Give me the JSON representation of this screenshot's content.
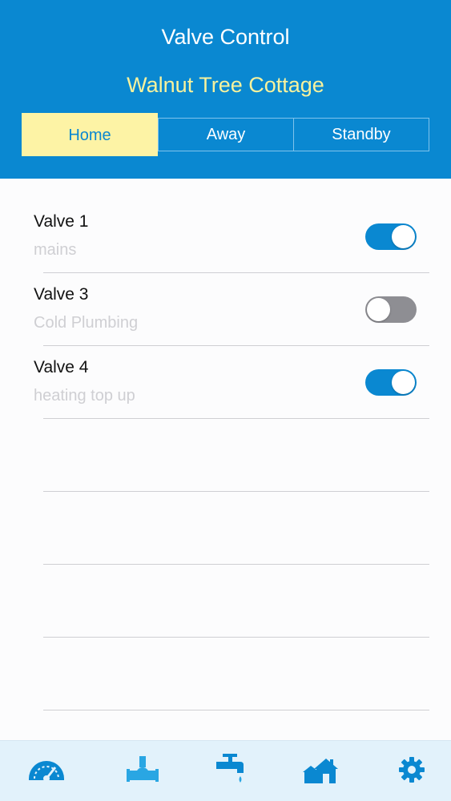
{
  "header": {
    "title": "Valve Control",
    "location": "Walnut Tree Cottage"
  },
  "modes": {
    "options": [
      "Home",
      "Away",
      "Standby"
    ],
    "selected": "Home"
  },
  "valves": [
    {
      "name": "Valve 1",
      "description": "mains",
      "enabled": true
    },
    {
      "name": "Valve 3",
      "description": "Cold Plumbing",
      "enabled": false
    },
    {
      "name": "Valve 4",
      "description": "heating top up",
      "enabled": true
    }
  ],
  "tabbar": {
    "tabs": [
      {
        "icon": "gauge-icon"
      },
      {
        "icon": "valve-icon"
      },
      {
        "icon": "tap-icon"
      },
      {
        "icon": "houses-icon"
      },
      {
        "icon": "gear-icon"
      }
    ]
  },
  "colors": {
    "primary": "#0a88d1",
    "accent_yellow": "#fdf3a5",
    "toggle_off": "#8e8e93",
    "tab_icon": "#0a88d1",
    "tab_icon_active": "#29a6e3"
  }
}
